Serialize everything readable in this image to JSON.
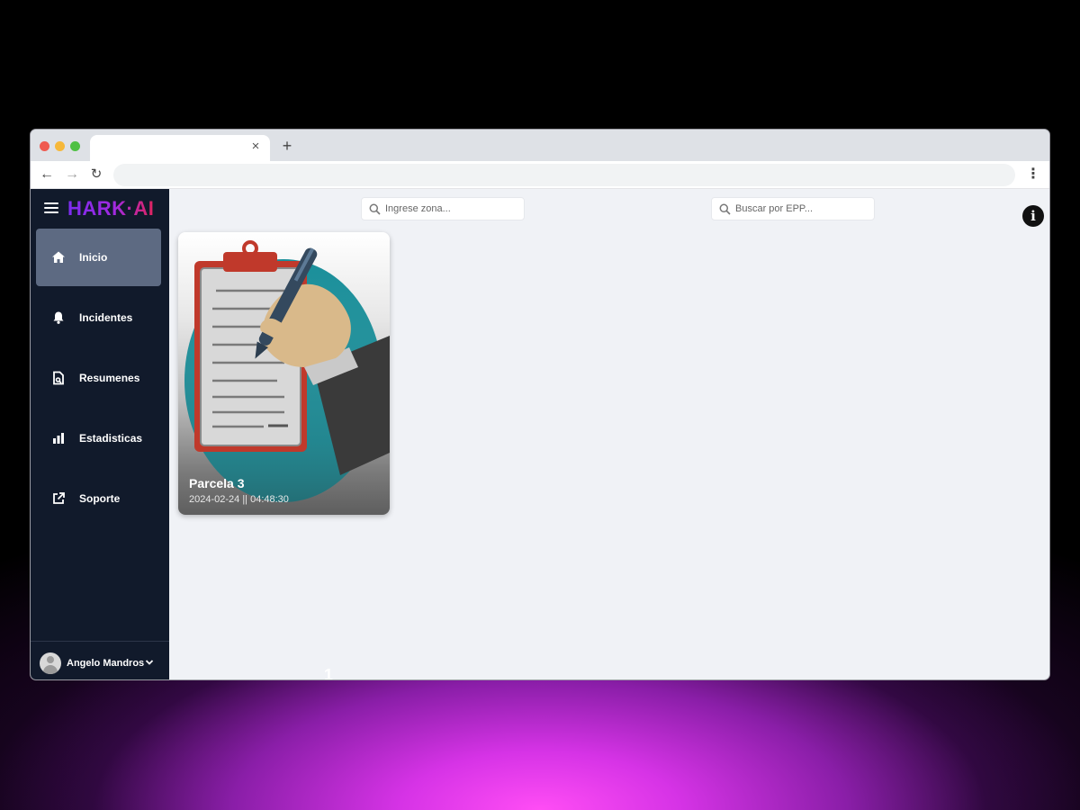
{
  "browser": {
    "tab_close_glyph": "×",
    "new_tab_glyph": "+",
    "back_glyph": "←",
    "forward_glyph": "→",
    "reload_glyph": "↻",
    "menu_glyph": "⋮"
  },
  "app": {
    "brand": "HARK·AI"
  },
  "sidebar": {
    "items": [
      {
        "label": "Inicio",
        "icon": "home-icon",
        "active": true
      },
      {
        "label": "Incidentes",
        "icon": "bell-icon",
        "active": false
      },
      {
        "label": "Resumenes",
        "icon": "document-icon",
        "active": false
      },
      {
        "label": "Estadisticas",
        "icon": "bar-chart-icon",
        "active": false
      },
      {
        "label": "Soporte",
        "icon": "external-link-icon",
        "active": false
      }
    ],
    "user": {
      "name": "Angelo Mandros"
    }
  },
  "search": {
    "zona_placeholder": "Ingrese zona...",
    "epp_placeholder": "Buscar por EPP..."
  },
  "info_glyph": "i",
  "cards": [
    {
      "title": "Parcela 3",
      "date": "2024-02-24 || 04:48:30"
    }
  ],
  "pagination": {
    "current": "1"
  },
  "colors": {
    "sidebar_bg": "#111a2b",
    "active_item_bg": "#5d6a82",
    "main_bg": "#f0f2f6",
    "brand_start": "#7b2cf0",
    "brand_end": "#e0245e"
  }
}
